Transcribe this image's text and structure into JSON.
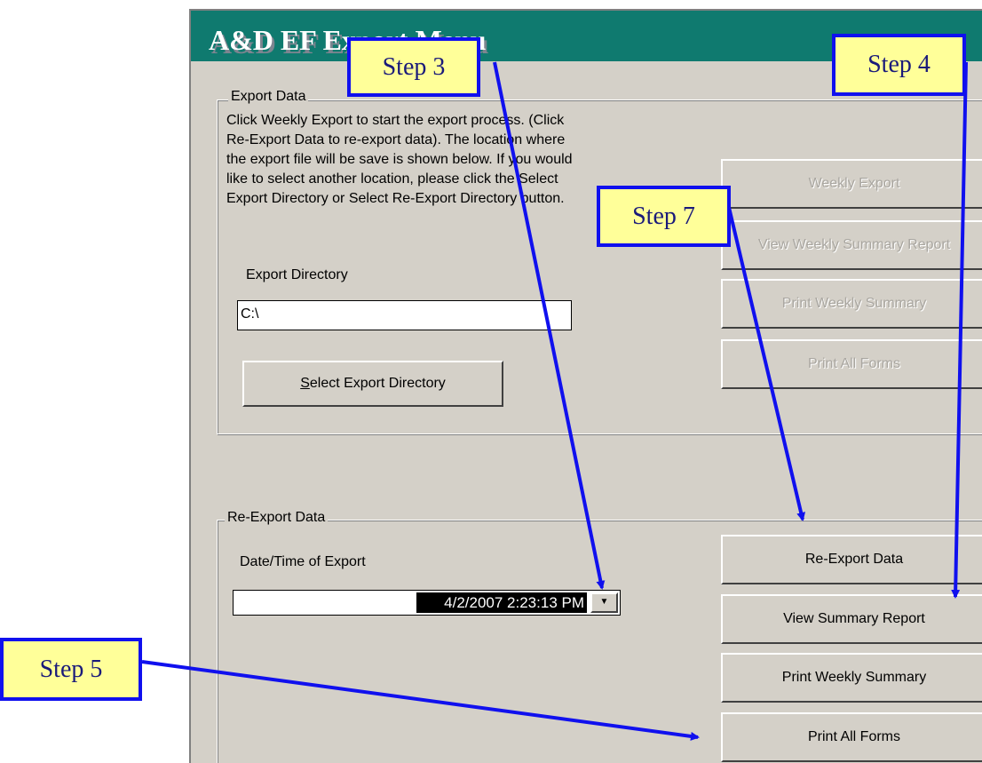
{
  "window": {
    "title": "A&D EF Export Menu"
  },
  "export_data": {
    "legend": "Export Data",
    "instructions": [
      "Click Weekly Export to start the export process. (Click",
      "Re-Export Data to re-export data). The location where",
      "the export file will be save is shown below. If you would",
      "like to select another location, please click the Select",
      "Export Directory or Select Re-Export Directory button."
    ],
    "directory_label": "Export Directory",
    "directory_value": "C:\\",
    "select_button_prefix": "S",
    "select_button_rest": "elect Export Directory"
  },
  "right_buttons_top": {
    "weekly_export": "Weekly Export",
    "view_weekly_summary": "View Weekly Summary Report",
    "print_weekly_summary": "Print Weekly Summary",
    "print_all_forms": "Print All Forms"
  },
  "reexport_data": {
    "legend": "Re-Export Data",
    "date_label": "Date/Time of Export",
    "date_value": "4/2/2007 2:23:13 PM"
  },
  "right_buttons_bottom": {
    "reexport": "Re-Export Data",
    "view_summary": "View Summary Report",
    "print_weekly_summary": "Print Weekly Summary",
    "print_all_forms": "Print All Forms"
  },
  "callouts": {
    "step3": "Step 3",
    "step4": "Step 4",
    "step5": "Step 5",
    "step7": "Step 7"
  },
  "colors": {
    "titlebar": "#0f7a6f",
    "dialog_bg": "#d4d0c8",
    "callout_fill": "#ffff99",
    "callout_border": "#1010ee"
  }
}
